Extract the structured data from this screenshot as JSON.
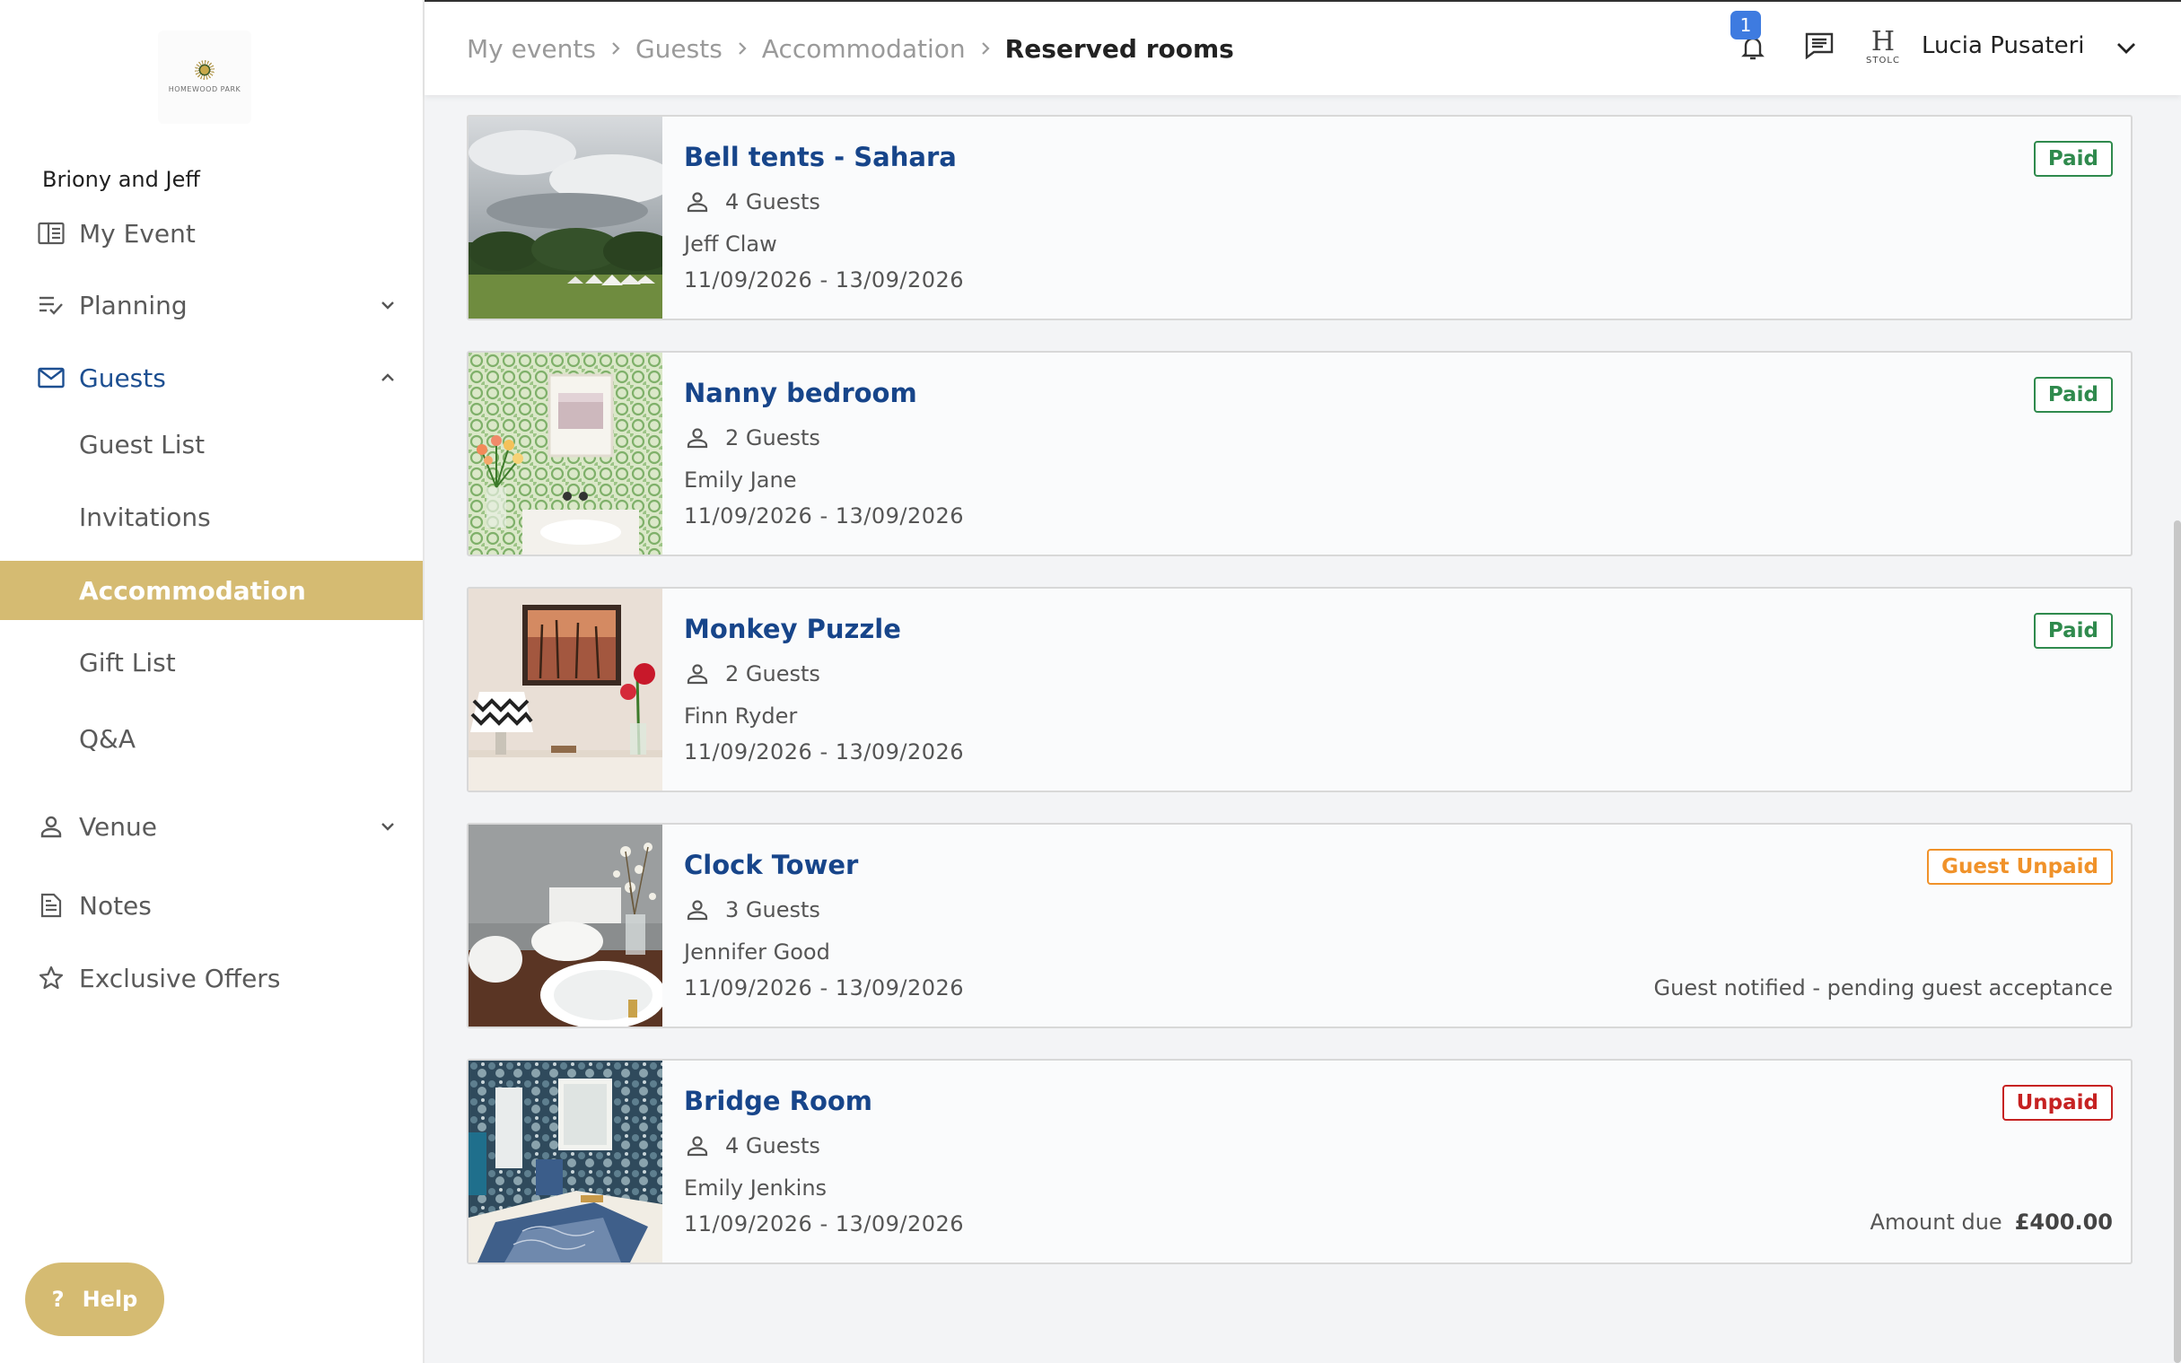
{
  "sidebar": {
    "logo": {
      "name": "HOMEWOOD PARK",
      "tagline": ""
    },
    "event_name": "Briony and Jeff",
    "items": {
      "my_event": {
        "label": "My Event",
        "icon": "book-open-icon"
      },
      "planning": {
        "label": "Planning",
        "icon": "checklist-icon"
      },
      "guests": {
        "label": "Guests",
        "icon": "envelope-icon"
      },
      "guest_list": {
        "label": "Guest List"
      },
      "invitations": {
        "label": "Invitations"
      },
      "accommodation": {
        "label": "Accommodation"
      },
      "gift_list": {
        "label": "Gift List"
      },
      "qa": {
        "label": "Q&A"
      },
      "venue": {
        "label": "Venue",
        "icon": "person-icon"
      },
      "notes": {
        "label": "Notes",
        "icon": "document-icon"
      },
      "exclusive_offers": {
        "label": "Exclusive Offers",
        "icon": "star-icon"
      }
    },
    "help_label": "Help"
  },
  "header": {
    "breadcrumb": [
      "My events",
      "Guests",
      "Accommodation",
      "Reserved rooms"
    ],
    "notification_count": "1",
    "user_name": "Lucia Pusateri",
    "user_avatar_letter": "H",
    "user_avatar_sub": "STOLC"
  },
  "rooms": [
    {
      "title": "Bell tents - Sahara",
      "guests": "4 Guests",
      "guest_name": "Jeff Claw",
      "dates": "11/09/2026 - 13/09/2026",
      "status": "Paid",
      "note": "",
      "amount_label": "",
      "amount": ""
    },
    {
      "title": "Nanny bedroom",
      "guests": "2 Guests",
      "guest_name": "Emily Jane",
      "dates": "11/09/2026 - 13/09/2026",
      "status": "Paid",
      "note": "",
      "amount_label": "",
      "amount": ""
    },
    {
      "title": "Monkey Puzzle",
      "guests": "2 Guests",
      "guest_name": "Finn Ryder",
      "dates": "11/09/2026 - 13/09/2026",
      "status": "Paid",
      "note": "",
      "amount_label": "",
      "amount": ""
    },
    {
      "title": "Clock Tower",
      "guests": "3 Guests",
      "guest_name": "Jennifer Good",
      "dates": "11/09/2026 - 13/09/2026",
      "status": "Guest Unpaid",
      "note": "Guest notified - pending guest acceptance",
      "amount_label": "",
      "amount": ""
    },
    {
      "title": "Bridge Room",
      "guests": "4 Guests",
      "guest_name": "Emily Jenkins",
      "dates": "11/09/2026 - 13/09/2026",
      "status": "Unpaid",
      "note": "",
      "amount_label": "Amount due",
      "amount": "£400.00"
    }
  ],
  "colors": {
    "accent_gold": "#d5bb72",
    "link_blue": "#17458a",
    "paid_green": "#2f8a4d",
    "guest_unpaid_orange": "#f0922a",
    "unpaid_red": "#c62222"
  }
}
